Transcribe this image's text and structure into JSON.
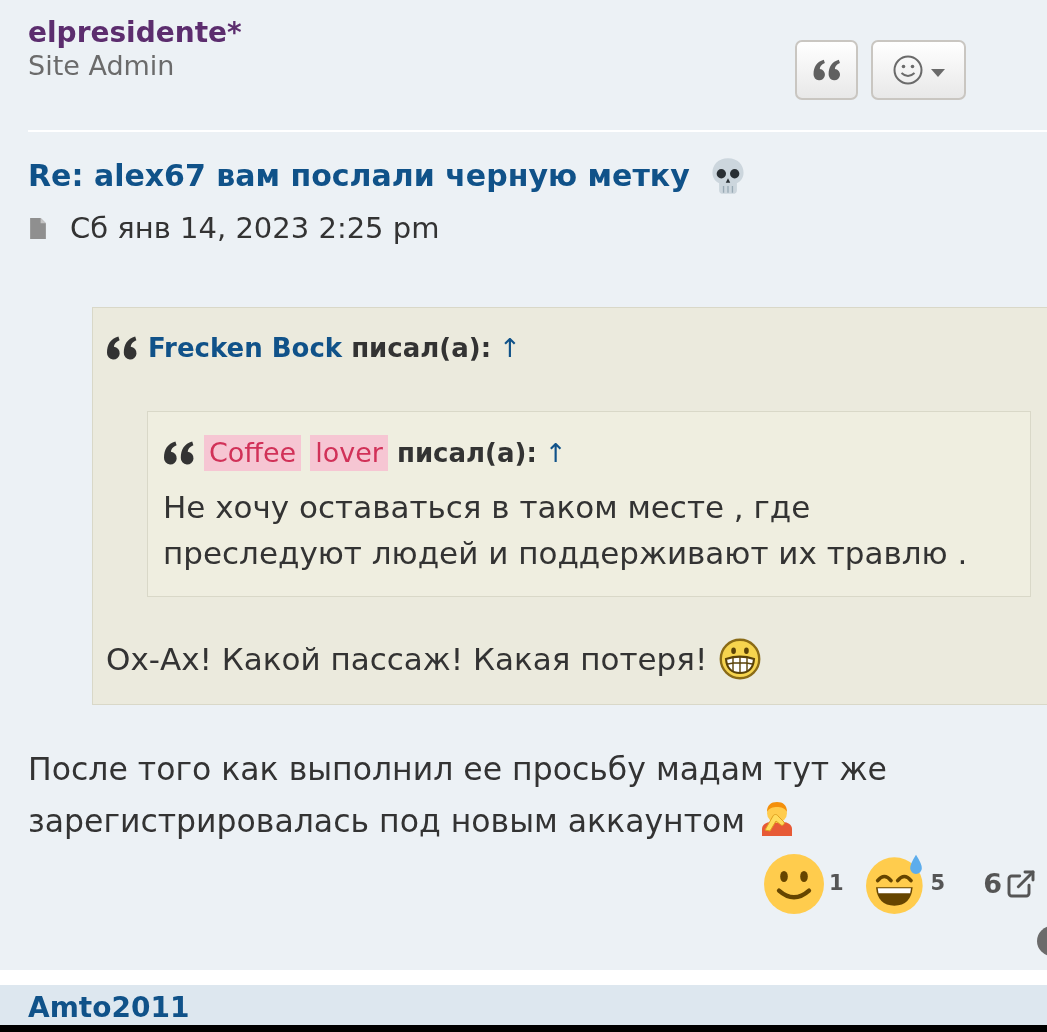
{
  "post": {
    "author": {
      "name": "elpresidente*",
      "rank": "Site Admin"
    },
    "title": "Re: alex67 вам послали черную метку",
    "date": "Сб янв 14, 2023 2:25 pm",
    "quote": {
      "author": "Frecken Bock",
      "wrote": "писал(а):",
      "jump": "↑",
      "nested_quote": {
        "author_words": [
          "Coffee",
          "lover"
        ],
        "wrote": "писал(а):",
        "jump": "↑",
        "text": "Не хочу оставаться в таком месте , где преследуют людей и поддерживают их травлю ."
      },
      "text": "Ох-Ах! Какой пассаж! Какая потеря!"
    },
    "text_lines": [
      "После того как выполнил ее просьбу мадам тут же",
      "зарегистрировалась под новым аккаунтом"
    ],
    "reactions": [
      {
        "kind": "smile",
        "count": "1"
      },
      {
        "kind": "sweat-smile",
        "count": "5"
      }
    ],
    "reaction_total": "6"
  },
  "next_post": {
    "author": "Amto2011"
  }
}
